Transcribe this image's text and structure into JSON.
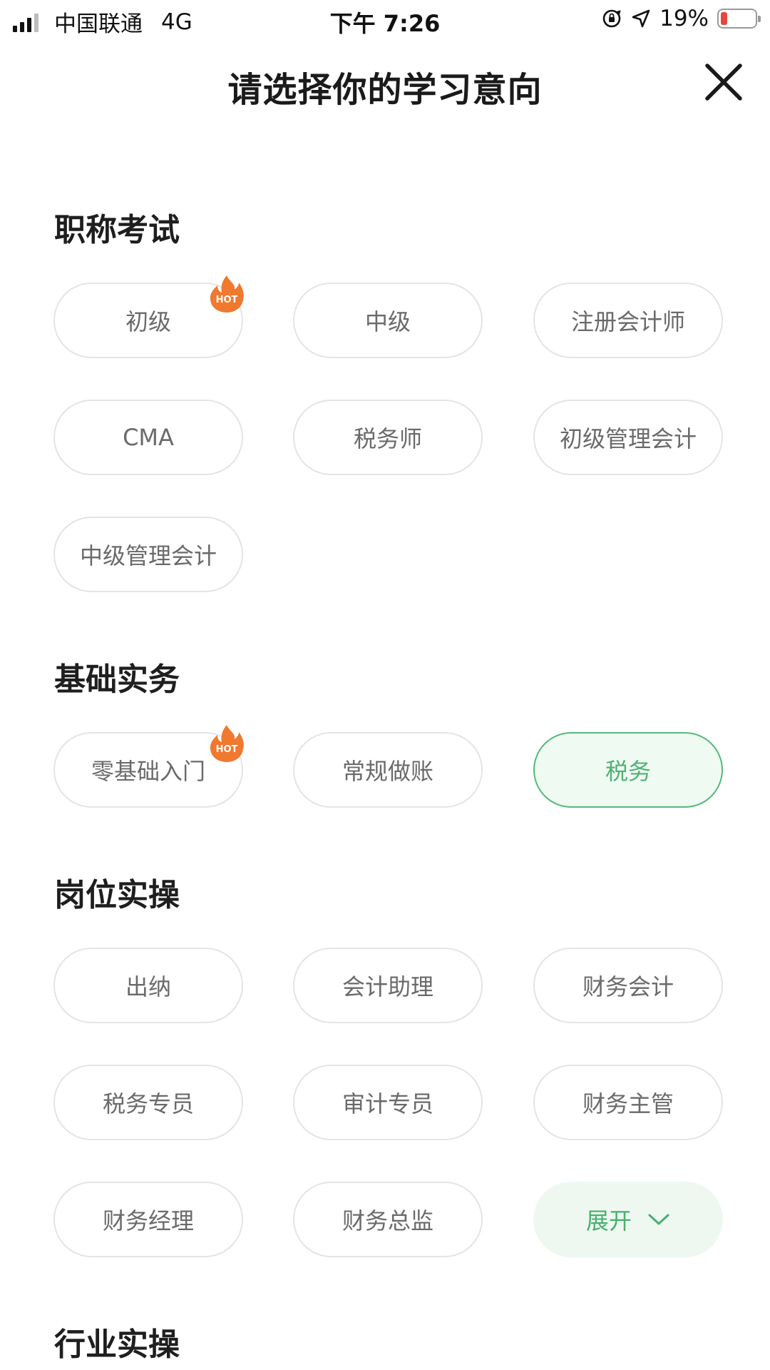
{
  "status_bar": {
    "carrier": "中国联通",
    "network": "4G",
    "time": "下午 7:26",
    "battery": "19%",
    "battery_level": 0.19
  },
  "header": {
    "title": "请选择你的学习意向",
    "close_icon": "close-icon"
  },
  "badge_text": "HOT",
  "sections": [
    {
      "title": "职称考试",
      "items": [
        {
          "label": "初级",
          "hot": true
        },
        {
          "label": "中级"
        },
        {
          "label": "注册会计师"
        },
        {
          "label": "CMA"
        },
        {
          "label": "税务师"
        },
        {
          "label": "初级管理会计"
        },
        {
          "label": "中级管理会计"
        }
      ]
    },
    {
      "title": "基础实务",
      "items": [
        {
          "label": "零基础入门",
          "hot": true
        },
        {
          "label": "常规做账"
        },
        {
          "label": "税务",
          "selected": true
        }
      ]
    },
    {
      "title": "岗位实操",
      "items": [
        {
          "label": "出纳"
        },
        {
          "label": "会计助理"
        },
        {
          "label": "财务会计"
        },
        {
          "label": "税务专员"
        },
        {
          "label": "审计专员"
        },
        {
          "label": "财务主管"
        },
        {
          "label": "财务经理"
        },
        {
          "label": "财务总监"
        }
      ],
      "expand_label": "展开"
    },
    {
      "title": "行业实操"
    }
  ],
  "colors": {
    "accent_green": "#4fb174",
    "selected_bg": "#eefaf2",
    "hot_orange": "#f0782f",
    "battery_low": "#e8453c"
  }
}
